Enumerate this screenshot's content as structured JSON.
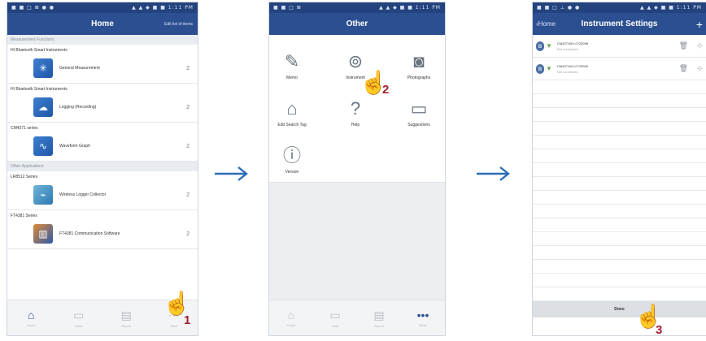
{
  "screens": [
    {
      "title": "Home",
      "header_right": "Edit list of items",
      "status_left": "■ ■ □ ⊠ ● ●",
      "status_right": "▲ ▲ ◆ ■ ■ 1:11 PM",
      "section1": "Measurement Functions",
      "groups": [
        {
          "title": "HI Bluetooth Smart Instruments",
          "label": "General Measurement",
          "num": "2",
          "icon": "✳"
        },
        {
          "title": "HI Bluetooth Smart Instruments",
          "label": "Logging (Recording)",
          "num": "2",
          "icon": "☁"
        },
        {
          "title": "CM4371 series",
          "label": "Waveform Graph",
          "num": "2",
          "icon": "∿"
        }
      ],
      "section2": "Other Applications",
      "groups2": [
        {
          "title": "LR8512 Series",
          "label": "Wireless Logger Collector",
          "num": "2",
          "icon": "⌁"
        },
        {
          "title": "FT4381 Series",
          "label": "FT4381 Communication Software",
          "num": "2",
          "icon": "▥"
        }
      ],
      "tabs": [
        "Home",
        "Data",
        "Report",
        "Other"
      ]
    },
    {
      "title": "Other",
      "status_left": "■ ■ □ ⊠",
      "status_right": "▲ ▲ ◆ ■ ■ 1:11 PM",
      "items": [
        {
          "label": "Memo",
          "icon": "✎"
        },
        {
          "label": "Instrument",
          "icon": "⊚"
        },
        {
          "label": "Photographs",
          "icon": "◙"
        },
        {
          "label": "Edit Search Tag",
          "icon": "⌂"
        },
        {
          "label": "Help",
          "icon": "?"
        },
        {
          "label": "Suggestions",
          "icon": "▭"
        },
        {
          "label": "Version",
          "icon": "ⓘ"
        }
      ],
      "tabs": [
        "Home",
        "Data",
        "Report",
        "Other"
      ],
      "more_icon": "•••"
    },
    {
      "title": "Instrument Settings",
      "back_label": "‹Home",
      "status_left": "■ ■ □ ⊥ ● ●",
      "status_right": "▲ ▲ ◆ ■ ■ 1:11 PM",
      "instruments": [
        {
          "id": "CM4371W1-0723098",
          "sub": "Not connected"
        },
        {
          "id": "CM4371W1-0723099",
          "sub": "Not connected"
        }
      ],
      "done": "Done"
    }
  ],
  "steps": [
    "1",
    "2",
    "3"
  ],
  "hand_icon": "☝"
}
